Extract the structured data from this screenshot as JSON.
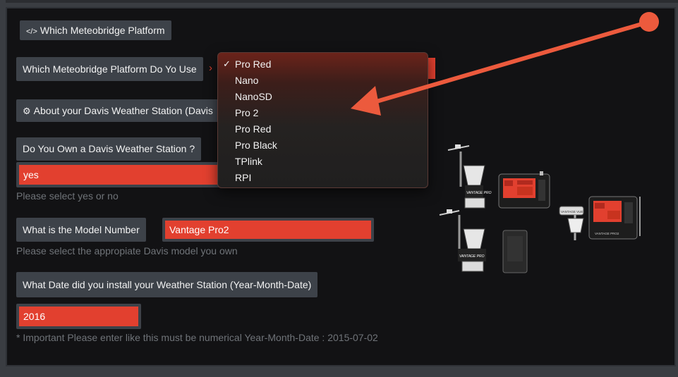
{
  "section1": {
    "icon": "code-icon",
    "title": "Which Meteobridge Platform"
  },
  "platform": {
    "label": "Which Meteobridge Platform Do Yo Use",
    "selected": "Pro Red"
  },
  "dropdown": {
    "options": [
      "Pro Red",
      "Nano",
      "NanoSD",
      "Pro 2",
      "Pro Red",
      "Pro Black",
      "TPlink",
      "RPI"
    ],
    "checked_index": 0
  },
  "section2": {
    "icon": "gear-icon",
    "title": "About your Davis Weather Station (Davis"
  },
  "own": {
    "label": "Do You Own a Davis Weather Station ?",
    "value": "yes",
    "hint": "Please select yes or no"
  },
  "model": {
    "label": "What is the Model Number",
    "value": "Vantage Pro2",
    "hint": "Please select the appropiate Davis model you own"
  },
  "install": {
    "label": "What Date did you install your Weather Station (Year-Month-Date)",
    "value": "2016",
    "hint": "* Important Please enter like this must be numerical Year-Month-Date : 2015-07-02"
  },
  "image_labels": {
    "vp1": "VANTAGE PRO",
    "vp2": "VANTAGE PRO",
    "vp3": "VANTAGE PRO2",
    "vp4": "VANTAGE VUE"
  },
  "colors": {
    "accent": "#e2402f",
    "panel": "#121214",
    "label_bg": "#3d4249"
  }
}
